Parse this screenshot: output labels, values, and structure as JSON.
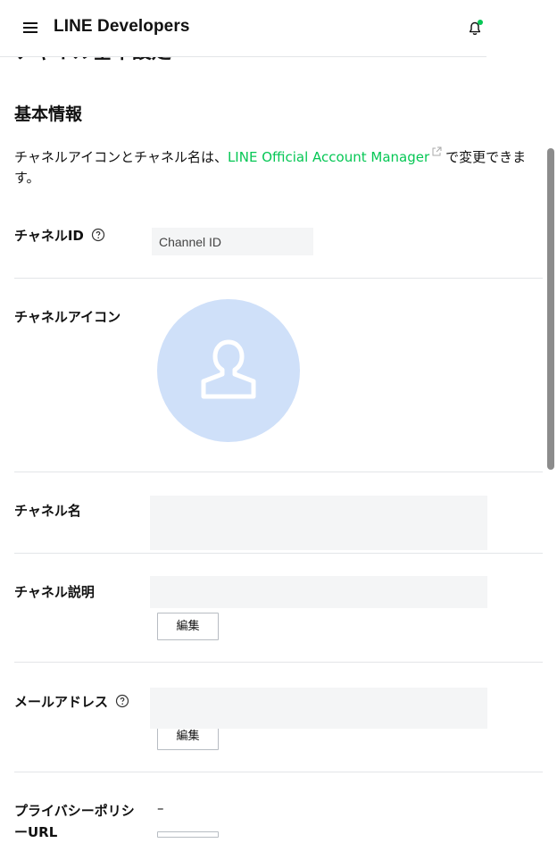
{
  "header": {
    "brand": "LINE Developers",
    "menu_icon": "hamburger-menu-icon",
    "notification_icon": "bell-icon",
    "accent": "#06c755"
  },
  "page": {
    "cut_title": "チャネル基本設定"
  },
  "basic_info": {
    "title": "基本情報",
    "intro_before": "チャネルアイコンとチャネル名は、",
    "intro_link": "LINE Official Account Manager",
    "intro_after": "で変更できます。"
  },
  "fields": {
    "channel_id": {
      "label": "チャネルID",
      "placeholder": "Channel ID"
    },
    "channel_icon": {
      "label": "チャネルアイコン"
    },
    "channel_name": {
      "label": "チャネル名"
    },
    "channel_description": {
      "label": "チャネル説明",
      "edit_label": "編集"
    },
    "email": {
      "label": "メールアドレス",
      "edit_label": "編集"
    },
    "privacy_policy": {
      "label_line1": "プライバシーポリシ",
      "label_line2": "ーURL",
      "value": "–"
    }
  }
}
